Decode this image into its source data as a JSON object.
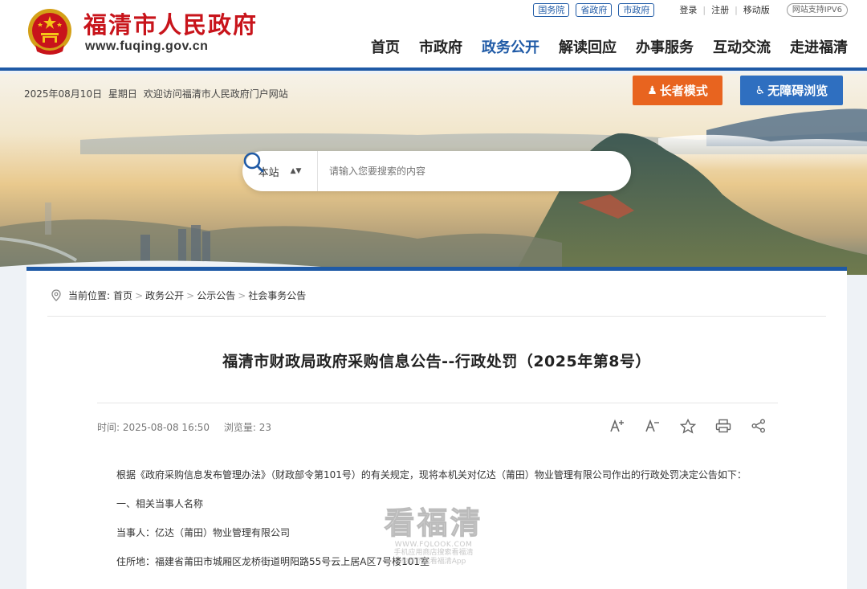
{
  "header": {
    "site_name": "福清市人民政府",
    "site_url": "www.fuqing.gov.cn",
    "gov_links": [
      "国务院",
      "省政府",
      "市政府"
    ],
    "account_links": [
      "登录",
      "注册",
      "移动版"
    ],
    "ipv6_badge": "网站支持IPV6",
    "nav": [
      {
        "label": "首页",
        "active": false
      },
      {
        "label": "市政府",
        "active": false
      },
      {
        "label": "政务公开",
        "active": true
      },
      {
        "label": "解读回应",
        "active": false
      },
      {
        "label": "办事服务",
        "active": false
      },
      {
        "label": "互动交流",
        "active": false
      },
      {
        "label": "走进福清",
        "active": false
      }
    ]
  },
  "banner": {
    "date": "2025年08月10日",
    "weekday": "星期日",
    "welcome": "欢迎访问福清市人民政府门户网站",
    "elder_mode": "长者模式",
    "accessible": "无障碍浏览",
    "search": {
      "scope": "本站",
      "placeholder": "请输入您要搜索的内容"
    }
  },
  "breadcrumb": {
    "label": "当前位置:",
    "items": [
      "首页",
      "政务公开",
      "公示公告",
      "社会事务公告"
    ]
  },
  "article": {
    "title": "福清市财政局政府采购信息公告--行政处罚（2025年第8号）",
    "time_label": "时间:",
    "time_value": "2025-08-08 16:50",
    "views_label": "浏览量:",
    "views_value": "23",
    "paragraphs": [
      "根据《政府采购信息发布管理办法》（财政部令第101号）的有关规定，现将本机关对亿达（莆田）物业管理有限公司作出的行政处罚决定公告如下：",
      "一、相关当事人名称",
      "当事人：亿达（莆田）物业管理有限公司",
      "住所地：福建省莆田市城厢区龙桥街道明阳路55号云上居A区7号楼101室"
    ]
  },
  "watermark": {
    "brand": "看福清",
    "url": "WWW.FQLOOK.COM",
    "line1": "手机应用商店搜索看福清",
    "line2": "也可下载看福清App"
  },
  "colors": {
    "brand_red": "#c8141b",
    "brand_blue": "#1f5aa6",
    "elder_orange": "#e8641f",
    "access_blue": "#2f6fc0"
  }
}
